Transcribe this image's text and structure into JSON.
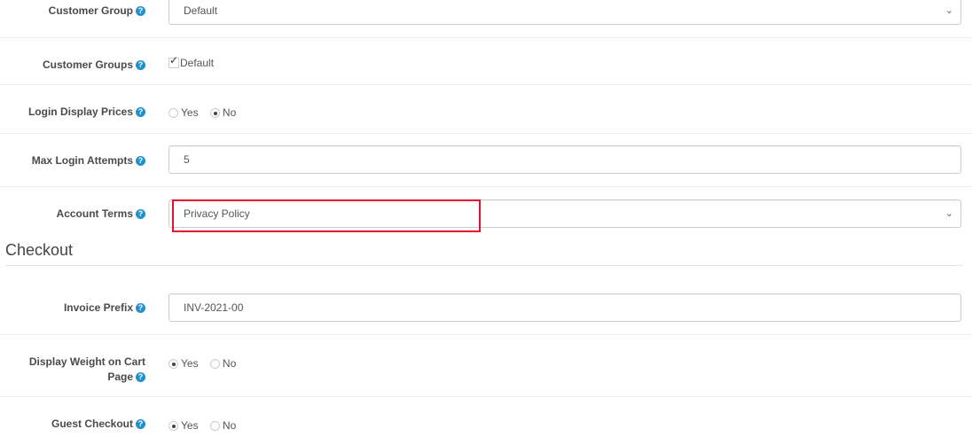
{
  "fields": {
    "customer_group": {
      "label": "Customer Group",
      "value": "Default",
      "type": "select"
    },
    "customer_groups": {
      "label": "Customer Groups",
      "options": [
        {
          "label": "Default",
          "checked": true
        }
      ]
    },
    "login_display_prices": {
      "label": "Login Display Prices",
      "options": [
        {
          "label": "Yes",
          "selected": false
        },
        {
          "label": "No",
          "selected": true
        }
      ]
    },
    "max_login_attempts": {
      "label": "Max Login Attempts",
      "value": "5"
    },
    "account_terms": {
      "label": "Account Terms",
      "value": "Privacy Policy",
      "type": "select"
    }
  },
  "section_checkout": {
    "title": "Checkout"
  },
  "checkout": {
    "invoice_prefix": {
      "label": "Invoice Prefix",
      "value": "INV-2021-00"
    },
    "display_weight": {
      "label_line1": "Display Weight on Cart",
      "label_line2": "Page",
      "options": [
        {
          "label": "Yes",
          "selected": true
        },
        {
          "label": "No",
          "selected": false
        }
      ]
    },
    "guest_checkout": {
      "label": "Guest Checkout",
      "options": [
        {
          "label": "Yes",
          "selected": true
        },
        {
          "label": "No",
          "selected": false
        }
      ]
    }
  },
  "icons": {
    "help": "?",
    "chevron": "⌄"
  },
  "colors": {
    "highlight": "#e8112d",
    "help_icon": "#1e91cf"
  }
}
